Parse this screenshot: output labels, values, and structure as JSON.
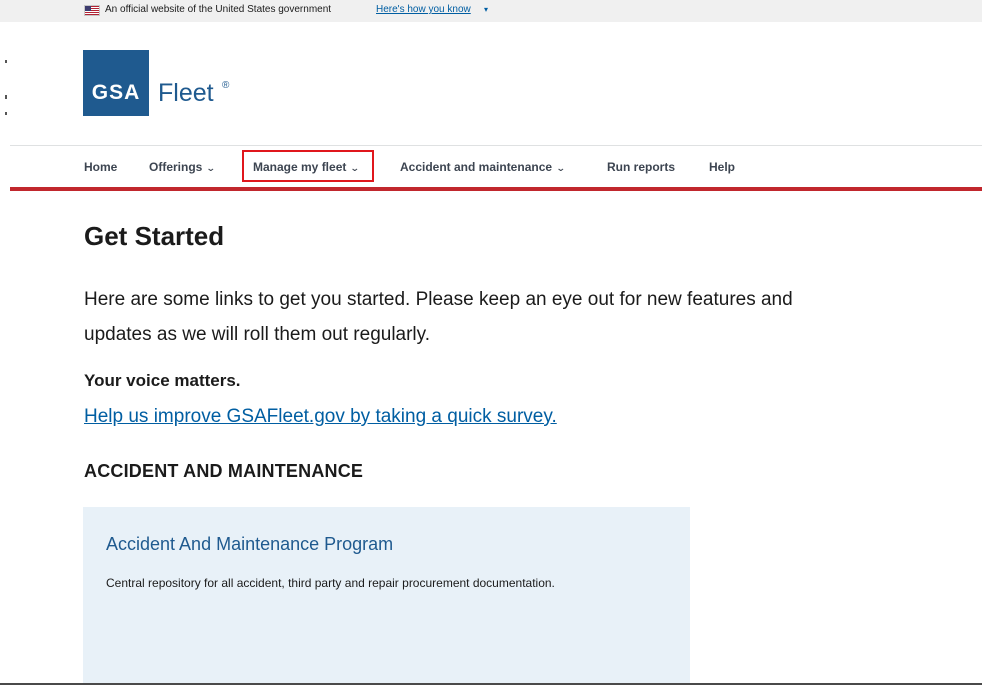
{
  "gov_banner": {
    "text": "An official website of the United States government",
    "link": "Here's how you know",
    "chevron_icon": "chevron-down-icon"
  },
  "logo": {
    "box_text": "GSA",
    "brand_text": "Fleet",
    "reg_mark": "®",
    "brand_color": "#1f5a8f"
  },
  "nav": {
    "items": [
      {
        "label": "Home",
        "has_menu": false
      },
      {
        "label": "Offerings",
        "has_menu": true
      },
      {
        "label": "Manage my fleet",
        "has_menu": true,
        "highlighted": true
      },
      {
        "label": "Accident and maintenance",
        "has_menu": true
      },
      {
        "label": "Run reports",
        "has_menu": false
      },
      {
        "label": "Help",
        "has_menu": false
      }
    ],
    "chevron": "⌄",
    "accent_color": "#c1272d",
    "highlight_color": "#e0171c"
  },
  "content": {
    "title": "Get Started",
    "intro": "Here are some links to get you started. Please keep an eye out for new features and updates as we will roll them out regularly.",
    "voice_title": "Your voice matters.",
    "survey_link": "Help us improve GSAFleet.gov by taking a quick survey.",
    "section_title": "ACCIDENT AND MAINTENANCE",
    "card": {
      "title": "Accident And Maintenance Program",
      "description": "Central repository for all accident, third party and repair procurement documentation."
    }
  }
}
